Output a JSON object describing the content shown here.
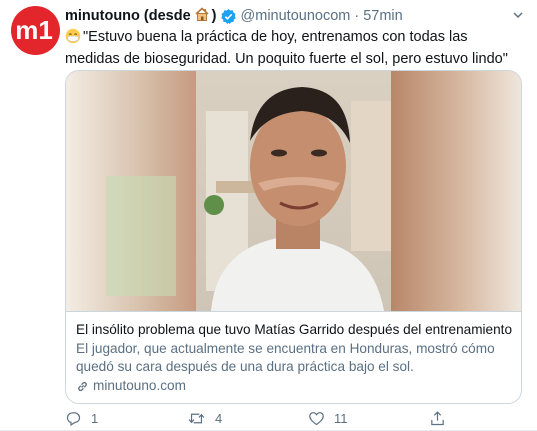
{
  "tweet": {
    "account_name": "minutouno (desde",
    "account_name_close": ")",
    "handle": "@minutounocom",
    "separator": "·",
    "time": "57min",
    "text": "\"Estuvo buena la práctica de hoy, entrenamos con todas las medidas de bioseguridad. Un poquito fuerte el sol, pero estuvo lindo\"",
    "avatar_logo_text": "m1",
    "icons": [
      "house-emoji-icon",
      "verified-badge-icon",
      "caret-down-icon",
      "face-mask-emoji-icon",
      "link-icon",
      "reply-icon",
      "retweet-icon",
      "like-icon",
      "share-icon"
    ],
    "accent_color": "#1da1f2",
    "brand_color": "#e3262b"
  },
  "card": {
    "title": "El insólito problema que tuvo Matías Garrido después del entrenamiento",
    "description": "El jugador, que actualmente se encuentra en Honduras, mostró cómo quedó su cara después de una dura práctica bajo el sol.",
    "domain": "minutouno.com"
  },
  "actions": {
    "reply_count": "1",
    "retweet_count": "4",
    "like_count": "11"
  }
}
